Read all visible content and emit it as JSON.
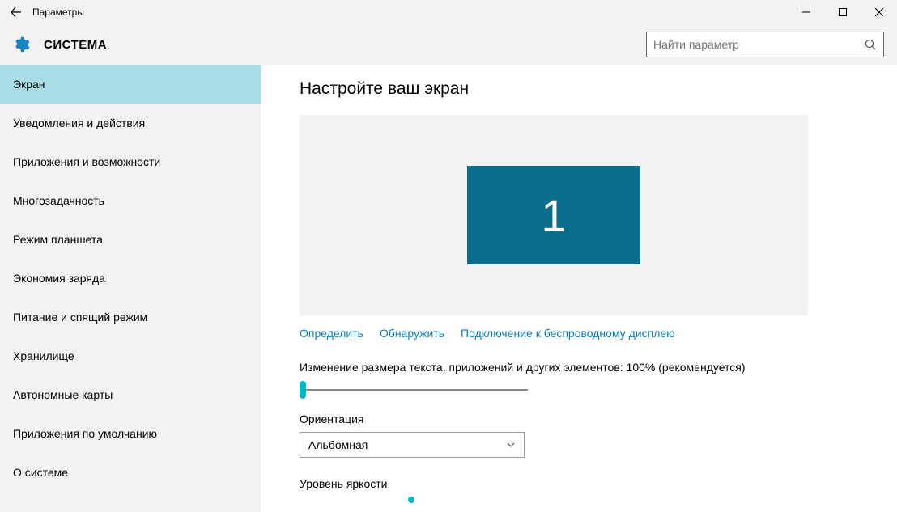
{
  "window": {
    "title": "Параметры"
  },
  "header": {
    "category": "СИСТЕМА",
    "search_placeholder": "Найти параметр"
  },
  "sidebar": {
    "items": [
      {
        "label": "Экран",
        "active": true
      },
      {
        "label": "Уведомления и действия",
        "active": false
      },
      {
        "label": "Приложения и возможности",
        "active": false
      },
      {
        "label": "Многозадачность",
        "active": false
      },
      {
        "label": "Режим планшета",
        "active": false
      },
      {
        "label": "Экономия заряда",
        "active": false
      },
      {
        "label": "Питание и спящий режим",
        "active": false
      },
      {
        "label": "Хранилище",
        "active": false
      },
      {
        "label": "Автономные карты",
        "active": false
      },
      {
        "label": "Приложения по умолчанию",
        "active": false
      },
      {
        "label": "О системе",
        "active": false
      }
    ]
  },
  "main": {
    "heading": "Настройте ваш экран",
    "monitor_number": "1",
    "links": {
      "identify": "Определить",
      "detect": "Обнаружить",
      "wireless": "Подключение к беспроводному дисплею"
    },
    "scale_label": "Изменение размера текста, приложений и других элементов: 100% (рекомендуется)",
    "orientation_label": "Ориентация",
    "orientation_value": "Альбомная",
    "brightness_label": "Уровень яркости"
  }
}
